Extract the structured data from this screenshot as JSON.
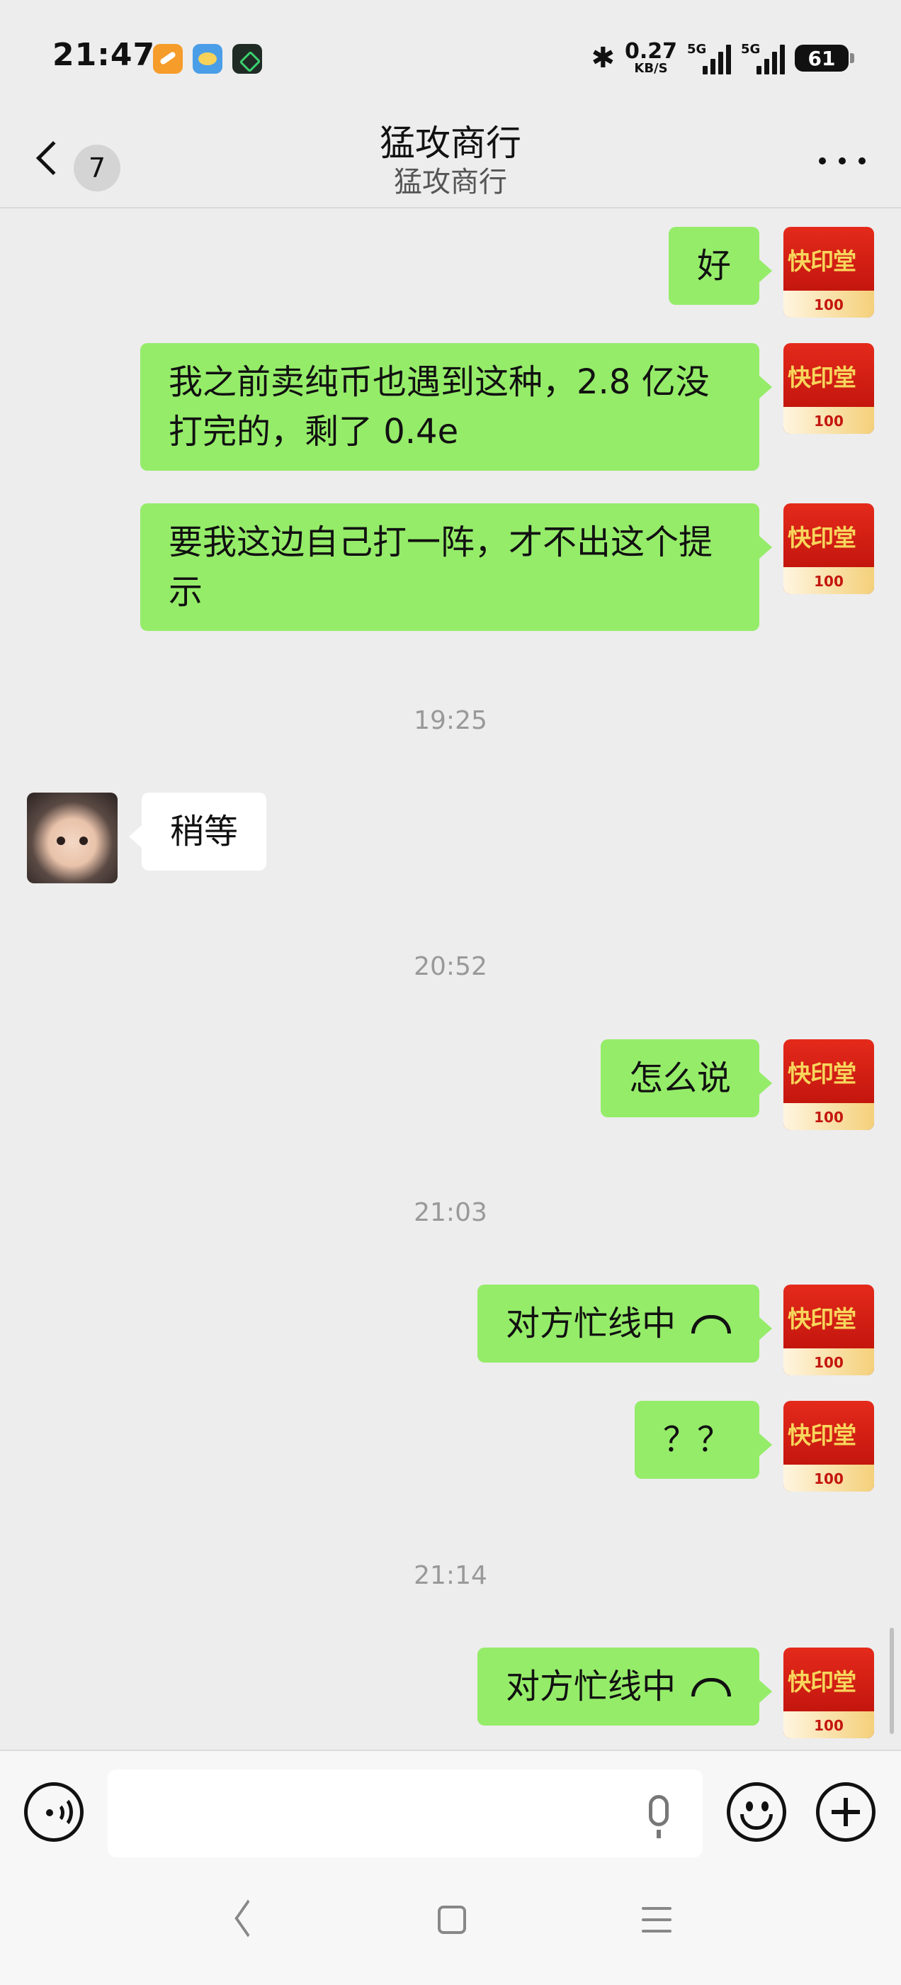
{
  "status_bar": {
    "time": "21:47",
    "net_speed_value": "0.27",
    "net_speed_unit": "KB/S",
    "signal_1_label": "5G",
    "signal_2_label": "5G",
    "battery": "61"
  },
  "header": {
    "back_count": "7",
    "title": "猛攻商行",
    "subtitle": "猛攻商行"
  },
  "avatars": {
    "me_text": "快印堂",
    "me_num": "100"
  },
  "messages": [
    {
      "from": "me",
      "text": "好"
    },
    {
      "from": "me",
      "text": "我之前卖纯币也遇到这种，2.8 亿没打完的，剩了 0.4e"
    },
    {
      "from": "me",
      "text": "要我这边自己打一阵，才不出这个提示"
    },
    {
      "type": "time",
      "text": "19:25"
    },
    {
      "from": "other",
      "text": "稍等"
    },
    {
      "type": "time",
      "text": "20:52"
    },
    {
      "from": "me",
      "text": "怎么说"
    },
    {
      "type": "time",
      "text": "21:03"
    },
    {
      "from": "me",
      "text": "对方忙线中",
      "icon": "phone-hangup-icon"
    },
    {
      "from": "me",
      "text": "？？"
    },
    {
      "type": "time",
      "text": "21:14"
    },
    {
      "from": "me",
      "text": "对方忙线中",
      "icon": "phone-hangup-icon"
    }
  ],
  "input": {
    "placeholder": ""
  },
  "colors": {
    "background": "#ededed",
    "bubble_out": "#95ec69",
    "bubble_in": "#ffffff"
  }
}
